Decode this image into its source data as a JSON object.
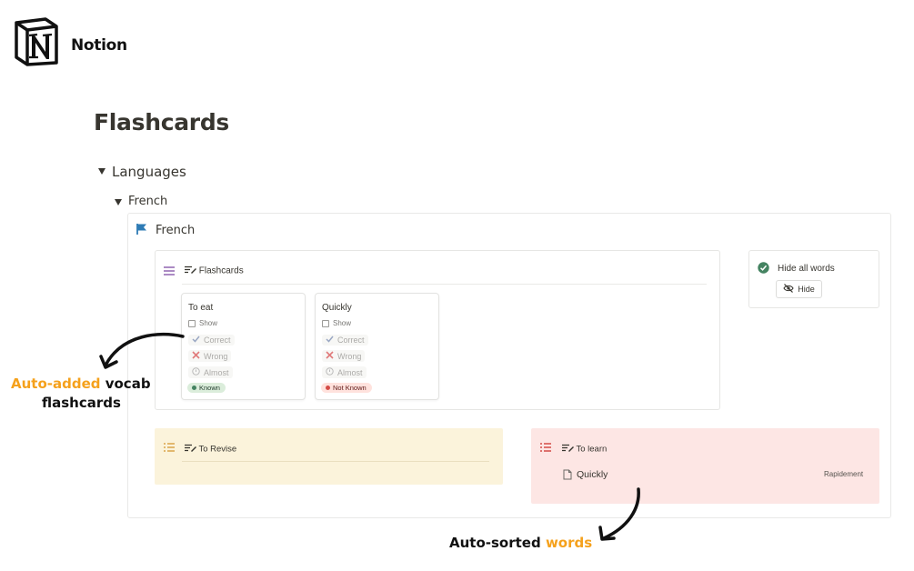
{
  "brand": {
    "name": "Notion"
  },
  "page": {
    "title": "Flashcards"
  },
  "tree": {
    "level1": "Languages",
    "level2": "French"
  },
  "french_block": {
    "title": "French",
    "flashcards_view": {
      "label": "Flashcards",
      "cards": [
        {
          "title": "To eat",
          "show_label": "Show",
          "correct": "Correct",
          "wrong": "Wrong",
          "almost": "Almost",
          "status": "Known"
        },
        {
          "title": "Quickly",
          "show_label": "Show",
          "correct": "Correct",
          "wrong": "Wrong",
          "almost": "Almost",
          "status": "Not Known"
        }
      ]
    },
    "hide_panel": {
      "label": "Hide all words",
      "button": "Hide"
    },
    "revise_view": {
      "label": "To Revise"
    },
    "learn_view": {
      "label": "To learn",
      "items": [
        {
          "word": "Quickly",
          "translation": "Rapidement"
        }
      ]
    }
  },
  "annotations": {
    "left_highlight": "Auto-added",
    "left_rest": " vocab",
    "left_line2": "flashcards",
    "bottom_start": "Auto-sorted ",
    "bottom_highlight": "words"
  },
  "colors": {
    "accent_orange": "#f5a11c",
    "revise_bg": "#fbf3db",
    "learn_bg": "#fde6e4",
    "known": "#448361",
    "not_known": "#d44c47"
  }
}
